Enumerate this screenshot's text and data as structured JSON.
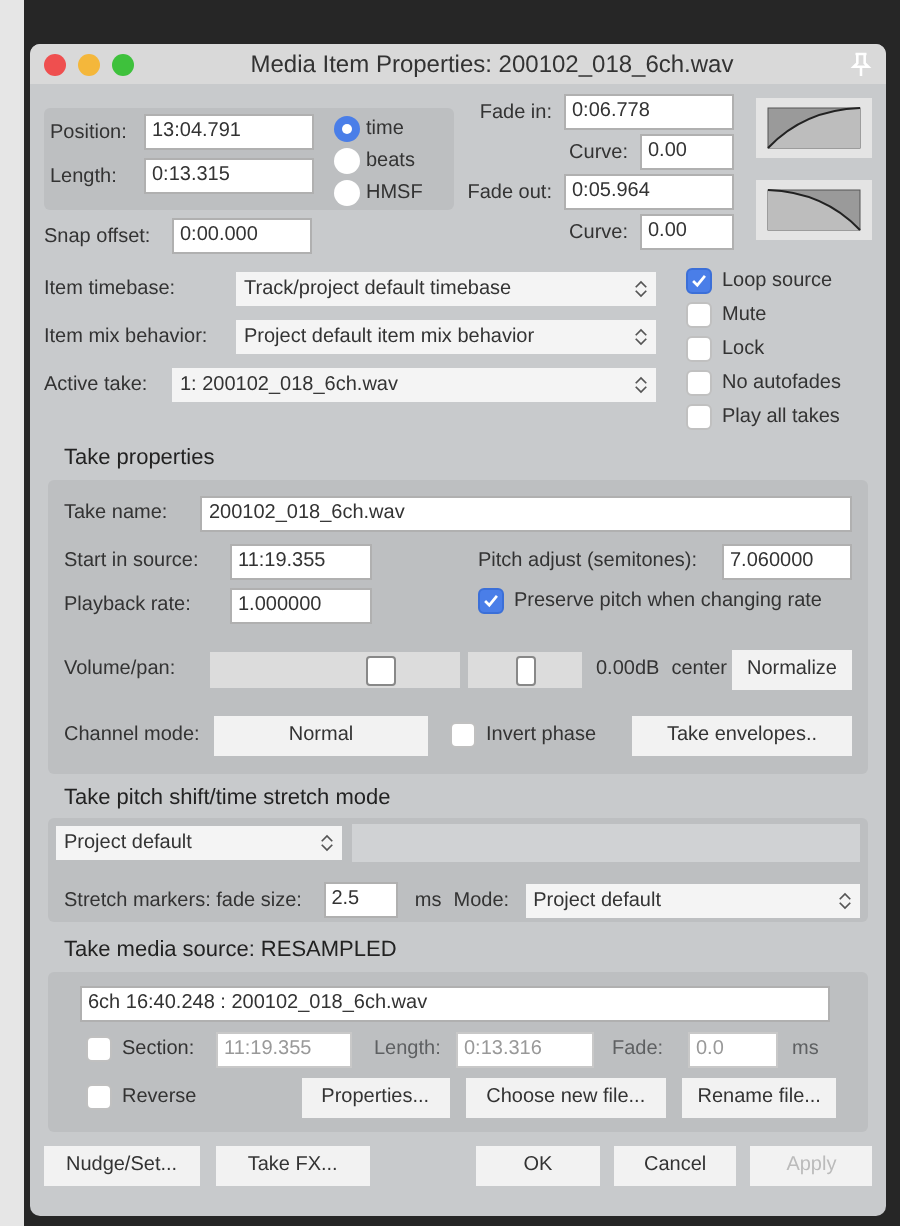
{
  "window": {
    "title": "Media Item Properties:  200102_018_6ch.wav"
  },
  "position": {
    "label": "Position:",
    "value": "13:04.791"
  },
  "length": {
    "label": "Length:",
    "value": "0:13.315"
  },
  "time_format": [
    {
      "label": "time",
      "selected": true
    },
    {
      "label": "beats",
      "selected": false
    },
    {
      "label": "HMSF",
      "selected": false
    }
  ],
  "snap_offset": {
    "label": "Snap offset:",
    "value": "0:00.000"
  },
  "fade_in": {
    "label": "Fade in:",
    "value": "0:06.778",
    "curve_label": "Curve:",
    "curve": "0.00"
  },
  "fade_out": {
    "label": "Fade out:",
    "value": "0:05.964",
    "curve_label": "Curve:",
    "curve": "0.00"
  },
  "selects": [
    {
      "label": "Item timebase:",
      "value": "Track/project default timebase"
    },
    {
      "label": "Item mix behavior:",
      "value": "Project default item mix behavior"
    },
    {
      "label": "Active take:",
      "value": "1: 200102_018_6ch.wav"
    }
  ],
  "options": [
    {
      "label": "Loop source",
      "checked": true
    },
    {
      "label": "Mute",
      "checked": false
    },
    {
      "label": "Lock",
      "checked": false
    },
    {
      "label": "No autofades",
      "checked": false
    },
    {
      "label": "Play all takes",
      "checked": false
    }
  ],
  "take_properties": {
    "heading": "Take properties",
    "take_name": {
      "label": "Take name:",
      "value": "200102_018_6ch.wav"
    },
    "start_in_source": {
      "label": "Start in source:",
      "value": "11:19.355"
    },
    "playback_rate": {
      "label": "Playback rate:",
      "value": "1.000000"
    },
    "pitch_adjust": {
      "label": "Pitch adjust (semitones):",
      "value": "7.060000"
    },
    "preserve_pitch": {
      "label": "Preserve pitch when changing rate",
      "checked": true
    },
    "volume_pan": {
      "label": "Volume/pan:",
      "volume": {
        "level": 0.68
      },
      "pan": {
        "level": 0.5
      },
      "volume_reading": "0.00dB",
      "pan_reading": "center"
    },
    "normalize_button": "Normalize",
    "channel_mode": {
      "label": "Channel mode:",
      "value": "Normal"
    },
    "invert_phase": {
      "label": "Invert phase",
      "checked": false
    },
    "take_envelopes_button": "Take envelopes.."
  },
  "pitch_shift": {
    "heading": "Take pitch shift/time stretch mode",
    "mode": "Project default",
    "fade_size": {
      "label": "Stretch markers: fade size:",
      "value": "2.5",
      "unit": "ms"
    },
    "mode_label": "Mode:",
    "stretch_mode": "Project default"
  },
  "media_source": {
    "heading": "Take media source:  RESAMPLED",
    "source": "6ch 16:40.248 : 200102_018_6ch.wav",
    "section": {
      "label": "Section:",
      "checked": false,
      "start": "11:19.355",
      "length_label": "Length:",
      "length": "0:13.316",
      "fade_label": "Fade:",
      "fade": "0.0",
      "unit": "ms"
    },
    "reverse": {
      "label": "Reverse",
      "checked": false
    },
    "buttons": [
      "Properties...",
      "Choose new file...",
      "Rename file..."
    ]
  },
  "buttons": [
    {
      "label": "Nudge/Set...",
      "disabled": false
    },
    {
      "label": "Take FX...",
      "disabled": false
    },
    {
      "label": "OK",
      "disabled": false
    },
    {
      "label": "Cancel",
      "disabled": false
    },
    {
      "label": "Apply",
      "disabled": true
    }
  ]
}
